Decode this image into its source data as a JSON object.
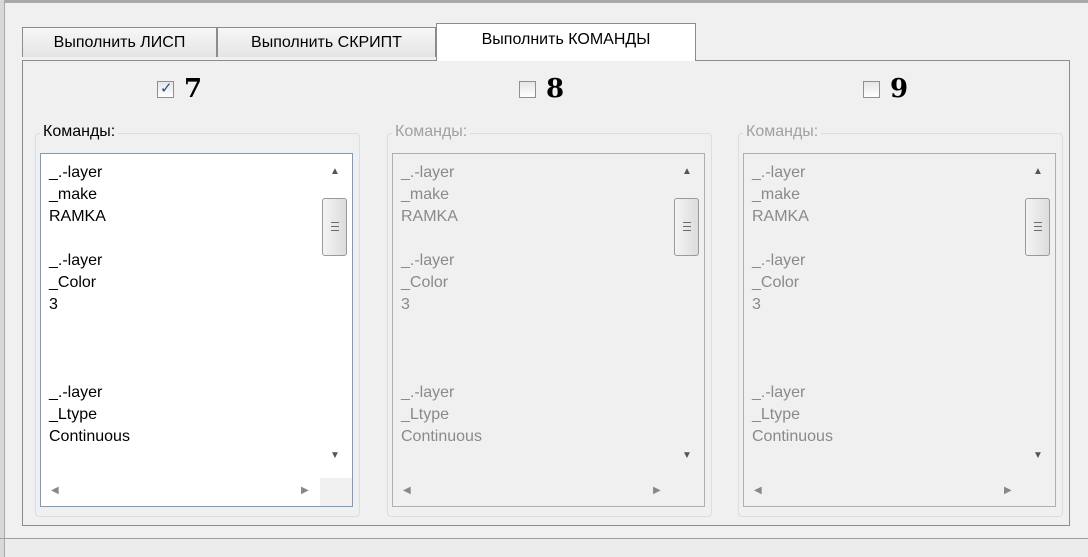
{
  "tabs": [
    {
      "label": "Выполнить ЛИСП",
      "active": false
    },
    {
      "label": "Выполнить СКРИПТ",
      "active": false
    },
    {
      "label": "Выполнить КОМАНДЫ",
      "active": true
    }
  ],
  "columns": [
    {
      "number": "7",
      "checked": true,
      "group_label": "Команды:",
      "enabled": true,
      "lines": [
        "_.-layer",
        "_make",
        "RAMKA",
        "",
        "_.-layer",
        "_Color",
        "3",
        "",
        "",
        "",
        "_.-layer",
        "_Ltype",
        "Continuous"
      ]
    },
    {
      "number": "8",
      "checked": false,
      "group_label": "Команды:",
      "enabled": false,
      "lines": [
        "_.-layer",
        "_make",
        "RAMKA",
        "",
        "_.-layer",
        "_Color",
        "3",
        "",
        "",
        "",
        "_.-layer",
        "_Ltype",
        "Continuous"
      ]
    },
    {
      "number": "9",
      "checked": false,
      "group_label": "Команды:",
      "enabled": false,
      "lines": [
        "_.-layer",
        "_make",
        "RAMKA",
        "",
        "_.-layer",
        "_Color",
        "3",
        "",
        "",
        "",
        "_.-layer",
        "_Ltype",
        "Continuous"
      ]
    }
  ],
  "icons": {
    "checkmark": "✓",
    "scroll_up": "▲",
    "scroll_down": "▼",
    "scroll_left": "◀",
    "scroll_right": "▶"
  },
  "colors": {
    "textbox_border_active": "#7a9cc4",
    "disabled_text": "#8a8a8a",
    "checkmark": "#2a4f8f"
  }
}
